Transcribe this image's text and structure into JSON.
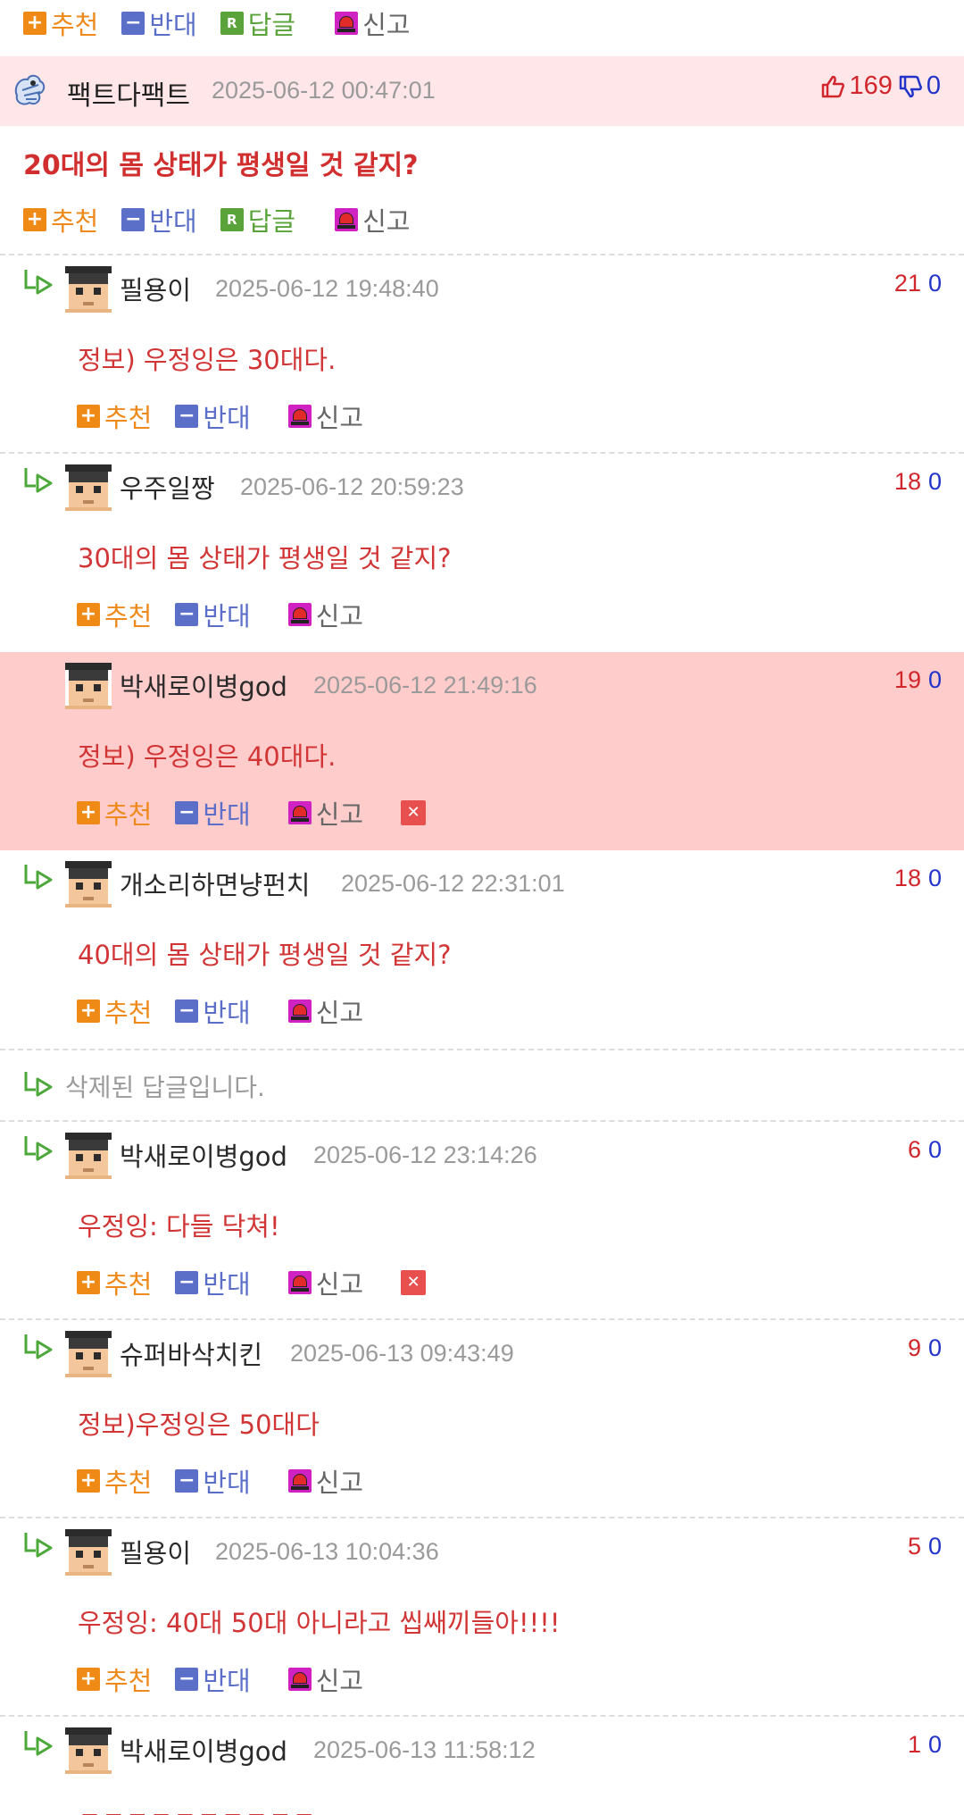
{
  "labels": {
    "recommend": "추천",
    "oppose": "반대",
    "reply": "답글",
    "report": "신고"
  },
  "post": {
    "author": "팩트다팩트",
    "date": "2025-06-12 00:47:01",
    "up": "169",
    "down": "0",
    "title": "20대의 몸 상태가 평생일 것 같지?"
  },
  "comments": [
    {
      "author": "필용이",
      "date": "2025-06-12 19:48:40",
      "up": "21",
      "down": "0",
      "text": "정보) 우정잉은 30대다."
    },
    {
      "author": "우주일짱",
      "date": "2025-06-12 20:59:23",
      "up": "18",
      "down": "0",
      "text": "30대의 몸 상태가 평생일 것 같지?"
    },
    {
      "author": "박새로이병god",
      "date": "2025-06-12 21:49:16",
      "up": "19",
      "down": "0",
      "text": "정보) 우정잉은 40대다.",
      "highlighted": true
    },
    {
      "author": "개소리하면냥펀치",
      "date": "2025-06-12 22:31:01",
      "up": "18",
      "down": "0",
      "text": "40대의 몸 상태가 평생일 것 같지?"
    },
    {
      "deleted_text": "삭제된 답글입니다."
    },
    {
      "author": "박새로이병god",
      "date": "2025-06-12 23:14:26",
      "up": "6",
      "down": "0",
      "text": "우정잉: 다들 닥쳐!"
    },
    {
      "author": "슈퍼바삭치킨",
      "date": "2025-06-13 09:43:49",
      "up": "9",
      "down": "0",
      "text": "정보)우정잉은 50대다"
    },
    {
      "author": "필용이",
      "date": "2025-06-13 10:04:36",
      "up": "5",
      "down": "0",
      "text": "우정잉: 40대 50대 아니라고 씹쌔끼들아!!!!"
    },
    {
      "author": "박새로이병god",
      "date": "2025-06-13 11:58:12",
      "up": "1",
      "down": "0",
      "text": "ㅋㅋㅋㅋㅋㅋㅋㅋㅋㅋ"
    }
  ],
  "colors": {
    "header_bg": "#ffe6e8",
    "highlight_bg": "#ffcccc",
    "comment_text": "#d13535",
    "up": "#d1262b",
    "down": "#2233c9"
  },
  "icons": [
    "plus-icon",
    "minus-icon",
    "reply-icon",
    "siren-icon",
    "delete-icon",
    "reply-arrow-icon",
    "thumbs-up-icon",
    "thumbs-down-icon",
    "user-avatar"
  ]
}
